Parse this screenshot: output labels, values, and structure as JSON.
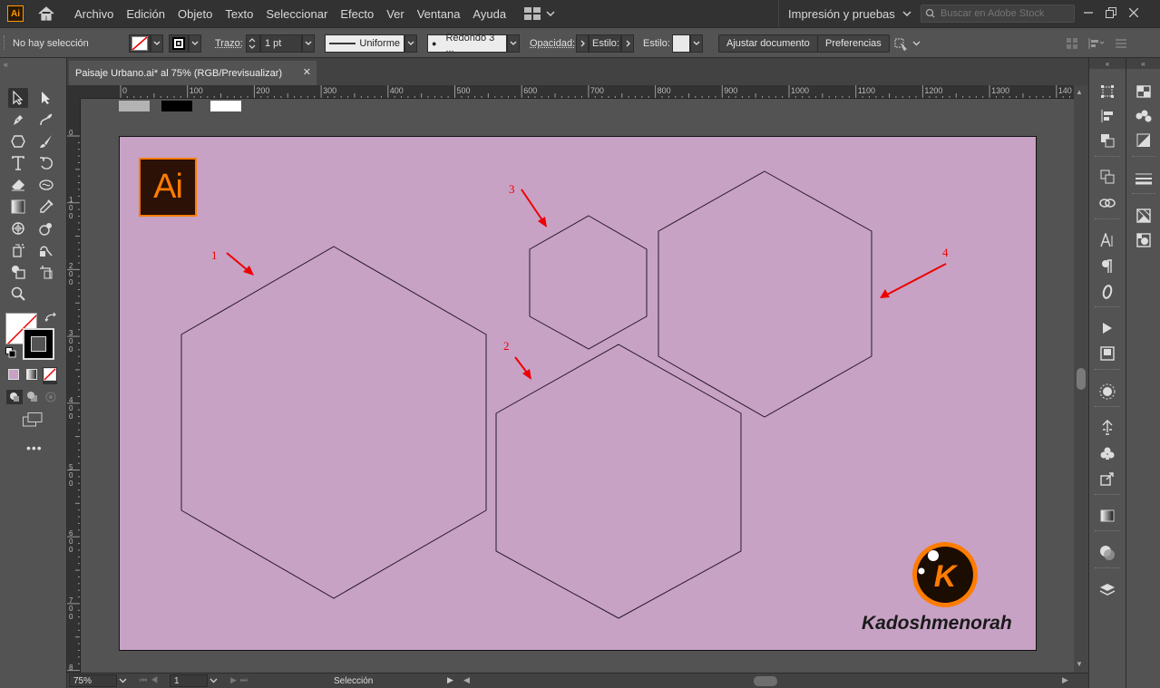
{
  "app": {
    "badge": "Ai",
    "menu": [
      "Archivo",
      "Edición",
      "Objeto",
      "Texto",
      "Seleccionar",
      "Efecto",
      "Ver",
      "Ventana",
      "Ayuda"
    ],
    "workspace": "Impresión y pruebas",
    "stock_search_placeholder": "Buscar en Adobe Stock"
  },
  "controlbar": {
    "selection": "No hay selección",
    "stroke_label": "Trazo:",
    "stroke_weight": "1 pt",
    "profile": "Uniforme",
    "brush": "Redondo 3 ...",
    "opacity_label": "Opacidad:",
    "style_field": "Estilo:",
    "style_label": "Estilo:",
    "adjust_button": "Ajustar documento",
    "prefs_button": "Preferencias"
  },
  "document": {
    "tab_title": "Paisaje Urbano.ai* al 75% (RGB/Previsualizar)",
    "zoom": "75%",
    "artboard_number": "1",
    "status_text": "Selección",
    "ruler_h": [
      "0",
      "100",
      "200",
      "300",
      "400",
      "500",
      "600",
      "700",
      "800",
      "900",
      "1000",
      "1100",
      "1200",
      "1300",
      "140"
    ],
    "ruler_v": [
      "0",
      "100",
      "200",
      "300",
      "400",
      "500",
      "600",
      "700",
      "800"
    ],
    "artboard_color": "#c7a2c5"
  },
  "canvas": {
    "logo_text": "Ai",
    "labels": [
      "1",
      "2",
      "3",
      "4"
    ],
    "watermark_letter": "K",
    "watermark_text": "Kadoshmenorah",
    "label_color": "#ff0000"
  }
}
